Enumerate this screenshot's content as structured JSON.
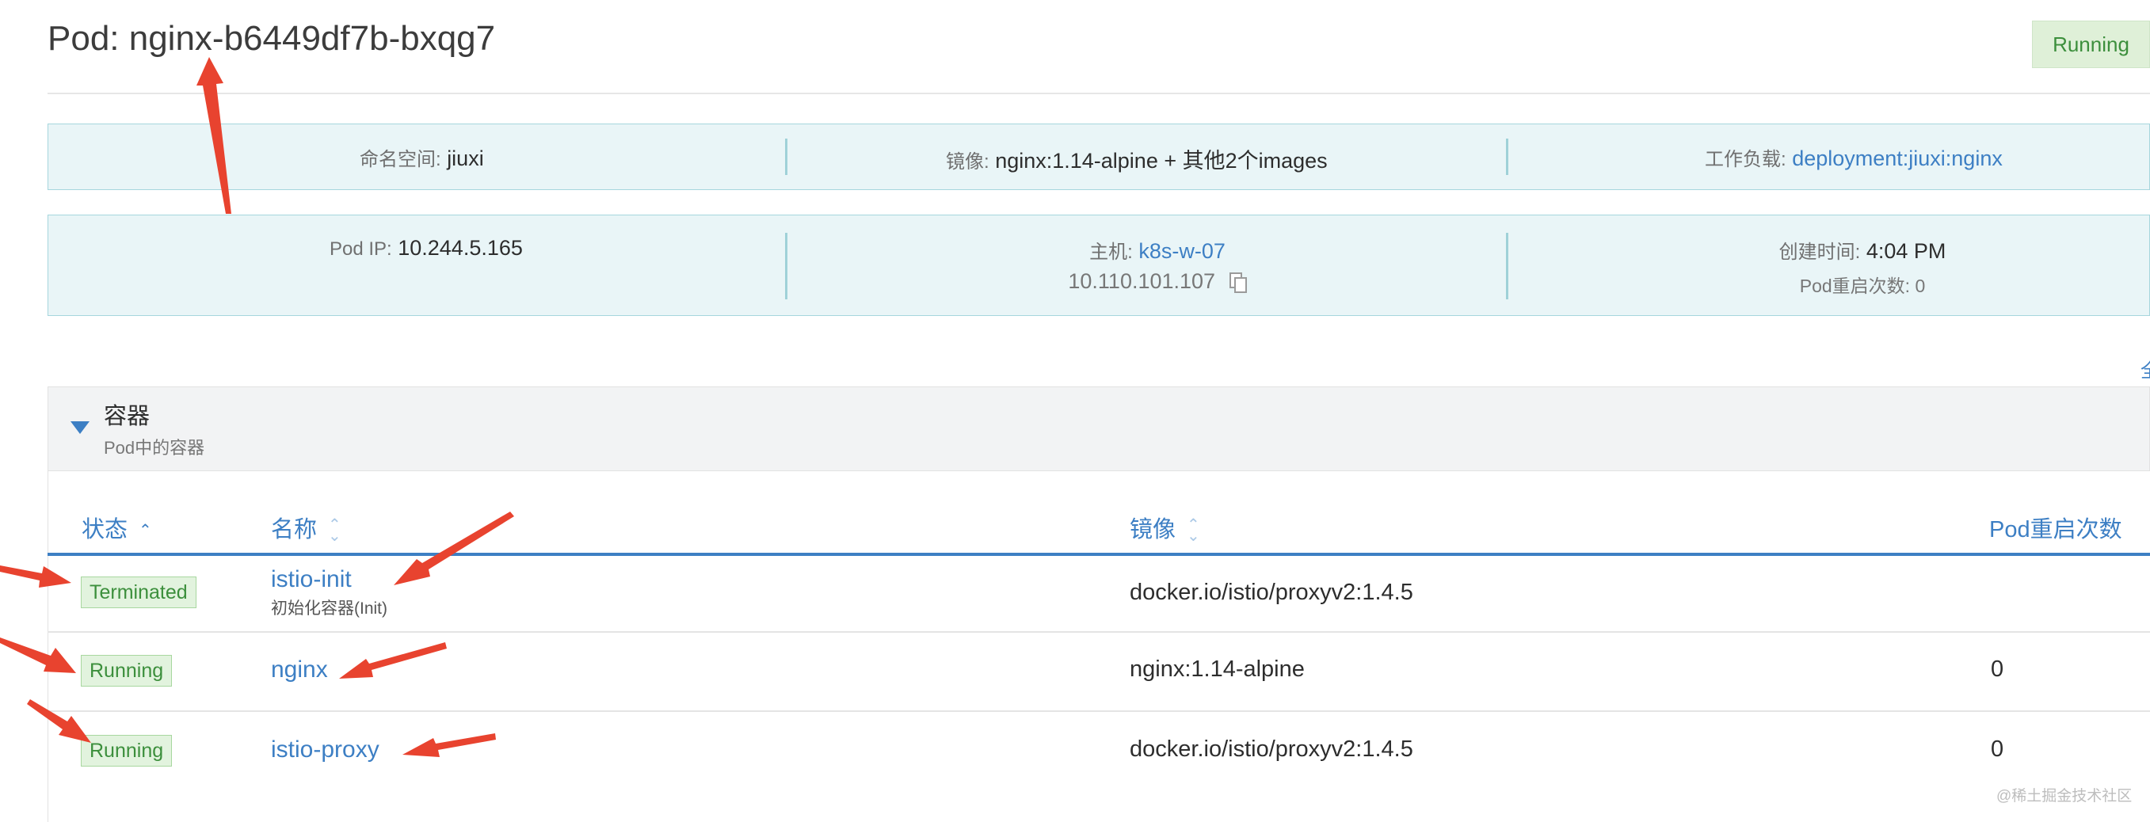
{
  "header": {
    "title": "Pod: nginx-b6449df7b-bxqg7",
    "status": "Running"
  },
  "info": {
    "namespace_label": "命名空间:",
    "namespace_value": "jiuxi",
    "image_label": "镜像:",
    "image_value": "nginx:1.14-alpine + 其他2个images",
    "workload_label": "工作负载:",
    "workload_value": "deployment:jiuxi:nginx",
    "pod_ip_label": "Pod IP:",
    "pod_ip_value": "10.244.5.165",
    "host_label": "主机:",
    "host_value": "k8s-w-07",
    "host_ip": "10.110.101.107",
    "created_label": "创建时间:",
    "created_value": "4:04 PM",
    "restarts_text": "Pod重启次数: 0"
  },
  "containers_section": {
    "title": "容器",
    "subtitle": "Pod中的容器",
    "columns": {
      "status": "状态",
      "name": "名称",
      "image": "镜像",
      "restarts": "Pod重启次数"
    },
    "rows": [
      {
        "status": "Terminated",
        "name": "istio-init",
        "sub": "初始化容器(Init)",
        "image": "docker.io/istio/proxyv2:1.4.5",
        "restarts": ""
      },
      {
        "status": "Running",
        "name": "nginx",
        "sub": "",
        "image": "nginx:1.14-alpine",
        "restarts": "0"
      },
      {
        "status": "Running",
        "name": "istio-proxy",
        "sub": "",
        "image": "docker.io/istio/proxyv2:1.4.5",
        "restarts": "0"
      }
    ]
  },
  "edge_glyph": "全",
  "watermark": "@稀土掘金技术社区",
  "colors": {
    "accent": "#3d7fc4",
    "panel_bg": "#e9f5f7",
    "running_bg": "#dff0d8",
    "running_text": "#3c8f3c",
    "arrow": "#e8432f"
  },
  "icons": [
    "copy-icon",
    "caret-down-icon",
    "sort-icon",
    "annotation-arrow-icon"
  ]
}
